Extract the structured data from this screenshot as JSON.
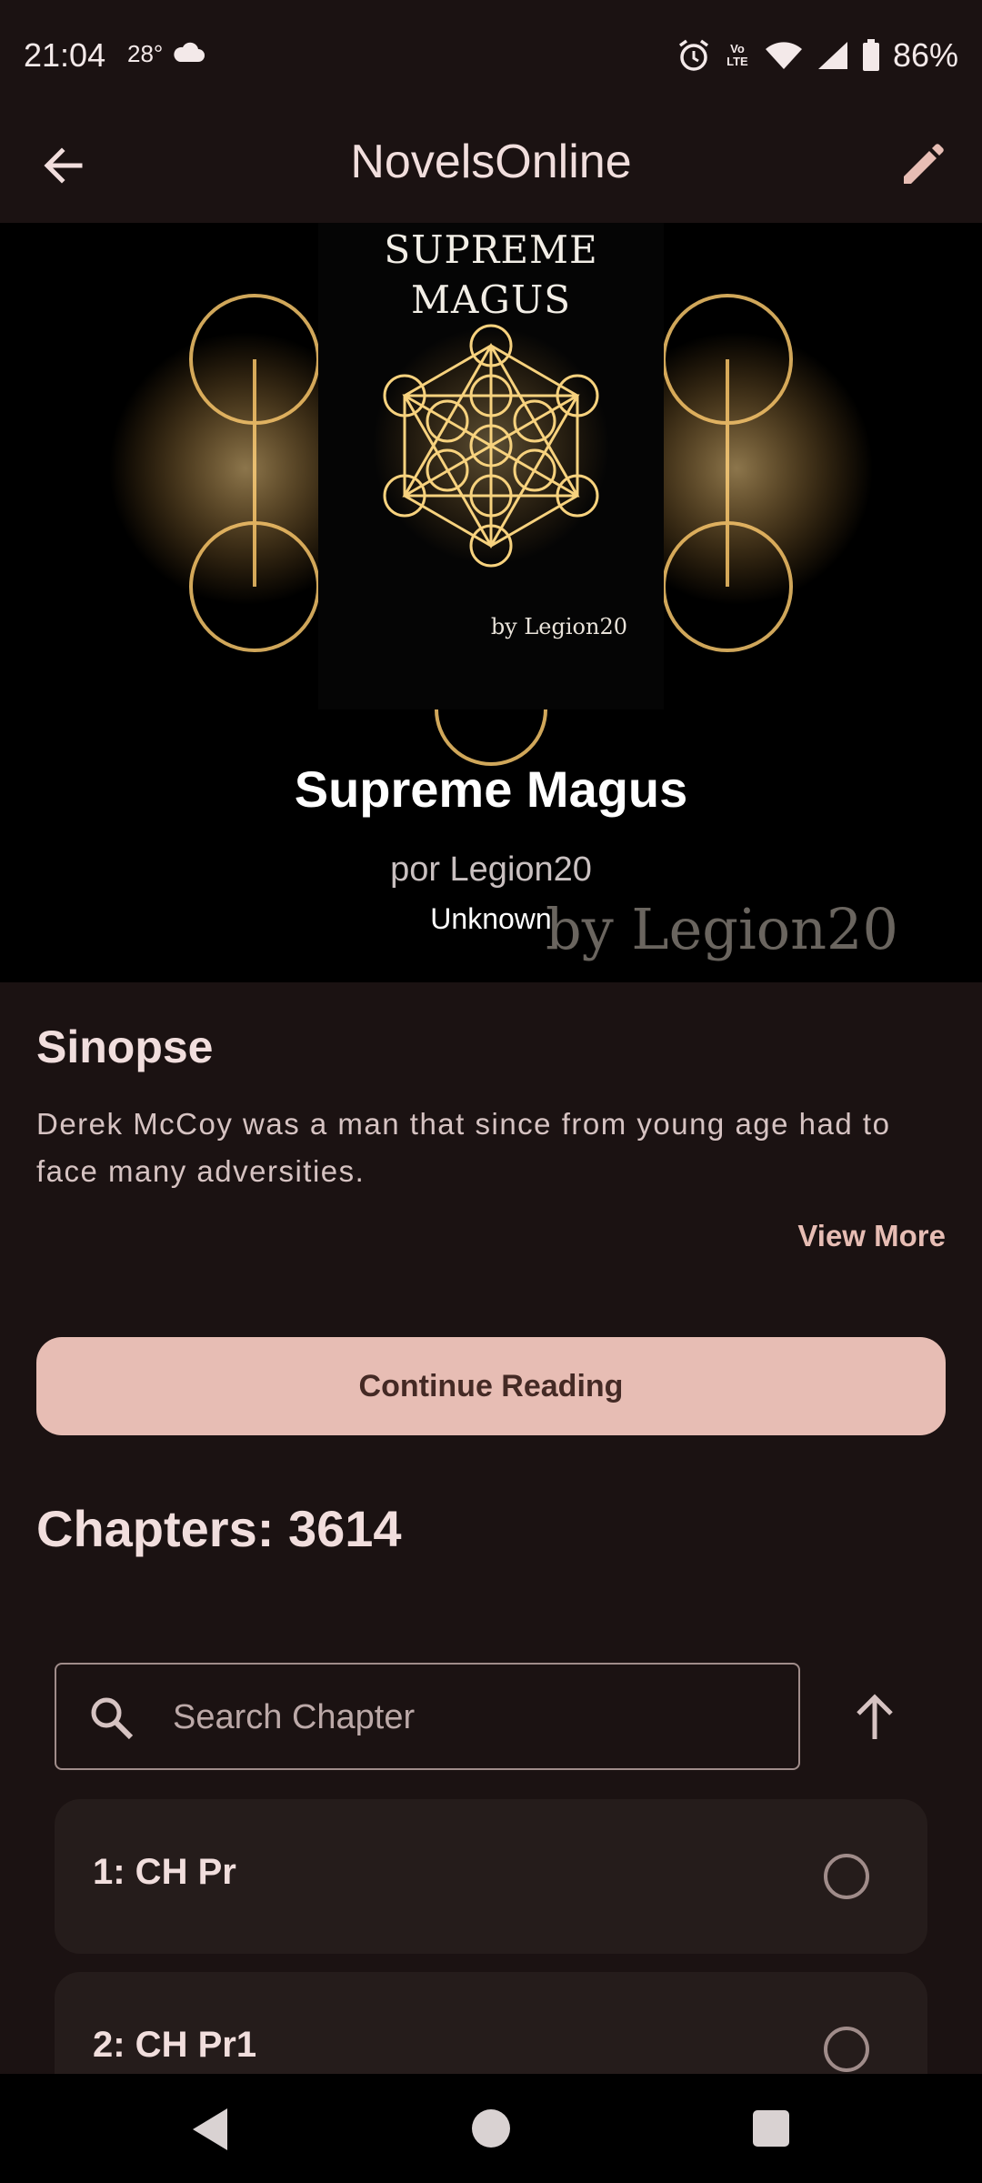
{
  "status_bar": {
    "time": "21:04",
    "temperature": "28°",
    "volte": "Vo LTE",
    "battery": "86%"
  },
  "app_bar": {
    "title": "NovelsOnline"
  },
  "cover": {
    "title_line1": "SUPREME",
    "title_line2": "MAGUS",
    "author": "by Legion20",
    "watermark": "by Legion20"
  },
  "book": {
    "title": "Supreme Magus",
    "author": "por Legion20",
    "status": "Unknown"
  },
  "synopsis": {
    "heading": "Sinopse",
    "text": "Derek McCoy was a man that since from young age had to face many adversities.",
    "view_more": "View More"
  },
  "continue_button": "Continue Reading",
  "chapters_count": "Chapters: 3614",
  "search": {
    "placeholder": "Search Chapter"
  },
  "chapters": [
    {
      "label": "1: CH Pr"
    },
    {
      "label": "2: CH Pr1"
    }
  ],
  "colors": {
    "background": "#1b1212",
    "accent": "#e7bdb4",
    "card": "#251c1b"
  }
}
